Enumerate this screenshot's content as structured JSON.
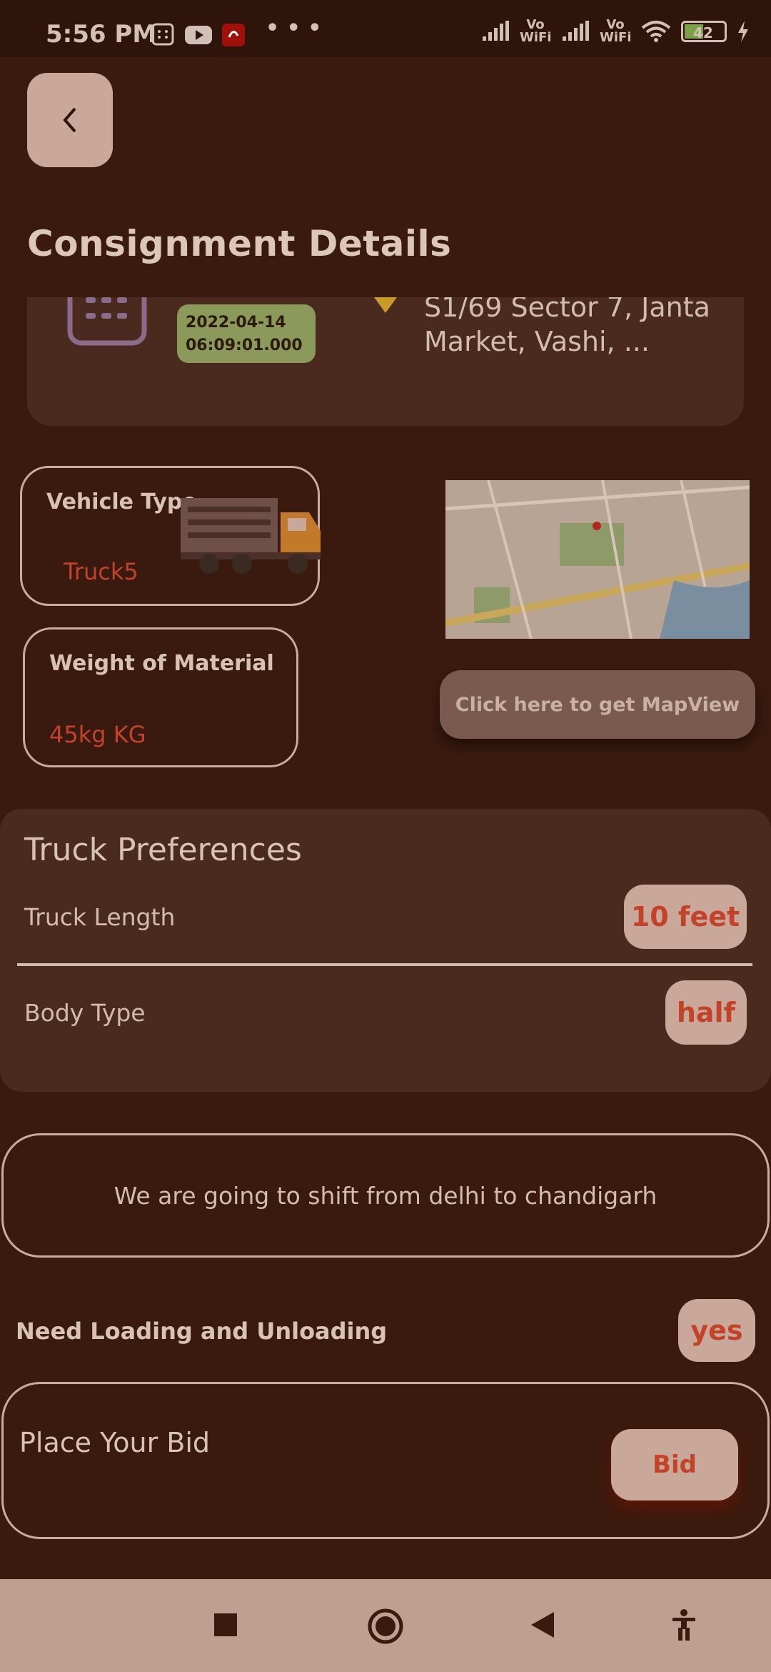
{
  "status_bar": {
    "time": "5:56 PM",
    "battery": "42",
    "vo_wifi_1": "Vo WiFi",
    "vo_wifi_2": "Vo WiFi",
    "more": "• • •"
  },
  "page": {
    "title": "Consignment Details"
  },
  "consignment": {
    "date_line1": "2022-04-14",
    "date_line2": "06:09:01.000",
    "address": "S1/69 Sector 7, Janta Market, Vashi, ..."
  },
  "vehicle": {
    "label": "Vehicle Type",
    "value": "Truck5"
  },
  "weight": {
    "label": "Weight of Material",
    "value": "45kg KG"
  },
  "map": {
    "button_label": "Click here to get MapView"
  },
  "truck_preferences": {
    "title": "Truck Preferences",
    "truck_length_label": "Truck Length",
    "truck_length_value": "10 feet",
    "body_type_label": "Body Type",
    "body_type_value": "half"
  },
  "description": "We are going to shift from delhi to chandigarh",
  "loading": {
    "label": "Need Loading and Unloading",
    "value": "yes"
  },
  "bid": {
    "label": "Place Your Bid",
    "button_label": "Bid"
  },
  "colors": {
    "background": "#3a1a0e",
    "card": "#4a2a1e",
    "accent_red": "#c2432a",
    "pill": "#c9a89a"
  }
}
